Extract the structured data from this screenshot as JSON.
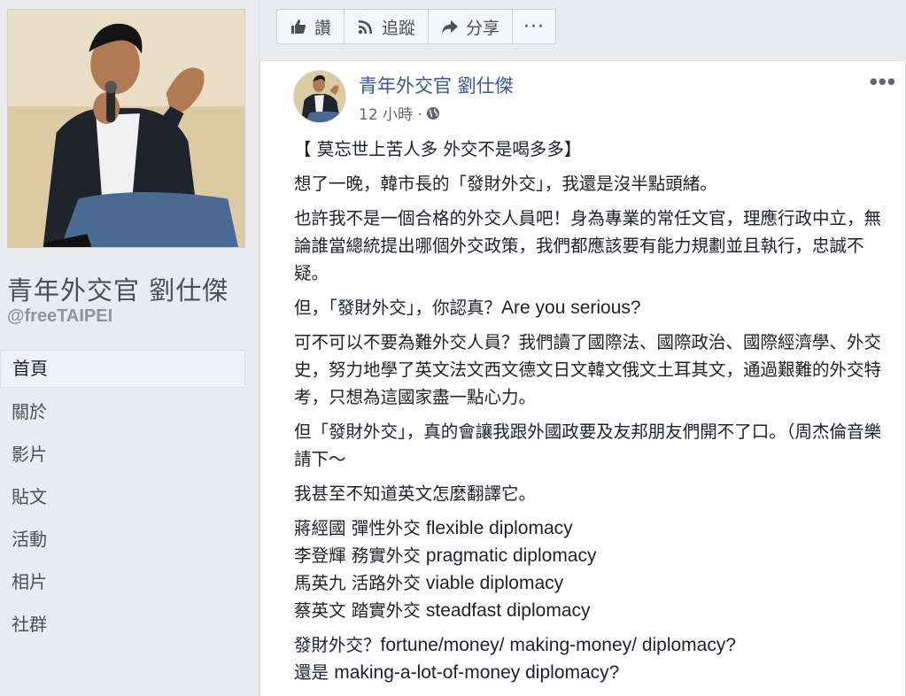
{
  "page": {
    "name": "青年外交官 劉仕傑",
    "handle": "@freeTAIPEI"
  },
  "nav": {
    "items": [
      {
        "label": "首頁",
        "active": true
      },
      {
        "label": "關於"
      },
      {
        "label": "影片"
      },
      {
        "label": "貼文"
      },
      {
        "label": "活動"
      },
      {
        "label": "相片"
      },
      {
        "label": "社群"
      }
    ]
  },
  "actions": {
    "like": {
      "label": "讚",
      "icon": "thumbs-up-icon"
    },
    "follow": {
      "label": "追蹤",
      "icon": "rss-icon"
    },
    "share": {
      "label": "分享",
      "icon": "share-arrow-icon"
    },
    "more": {
      "label": "···"
    }
  },
  "post": {
    "author": "青年外交官 劉仕傑",
    "time": "12 小時 ·",
    "options": "•••",
    "paragraphs": {
      "p1": "【 莫忘世上苦人多 外交不是喝多多】",
      "p2": "想了一晚，韓市長的「發財外交」，我還是沒半點頭緒。",
      "p3": "也許我不是一個合格的外交人員吧！身為專業的常任文官，理應行政中立，無論誰當總統提出哪個外交政策，我們都應該要有能力規劃並且執行，忠誠不疑。",
      "p4_zh": "但，「發財外交」，你認真？",
      "p4_en": "Are you serious?",
      "p5": "可不可以不要為難外交人員？我們讀了國際法、國際政治、國際經濟學、外交史，努力地學了英文法文西文德文日文韓文俄文土耳其文，通過艱難的外交特考，只想為這國家盡一點心力。",
      "p6": "但「發財外交」，真的會讓我跟外國政要及友邦朋友們開不了口。（周杰倫音樂請下～",
      "p7": "我甚至不知道英文怎麼翻譯它。"
    },
    "diplomacy": [
      {
        "zh": "蔣經國 彈性外交",
        "en": "flexible diplomacy"
      },
      {
        "zh": "李登輝 務實外交",
        "en": "pragmatic diplomacy"
      },
      {
        "zh": "馬英九 活路外交",
        "en": "viable diplomacy"
      },
      {
        "zh": "蔡英文 踏實外交",
        "en": "steadfast diplomacy"
      }
    ],
    "closing": {
      "l1_zh": "發財外交？",
      "l1_en": "fortune/money/ making-money/ diplomacy?",
      "l2_zh": "還是",
      "l2_en": "making-a-lot-of-money diplomacy?"
    }
  },
  "colors": {
    "link": "#365899",
    "background": "#e9ebee"
  }
}
